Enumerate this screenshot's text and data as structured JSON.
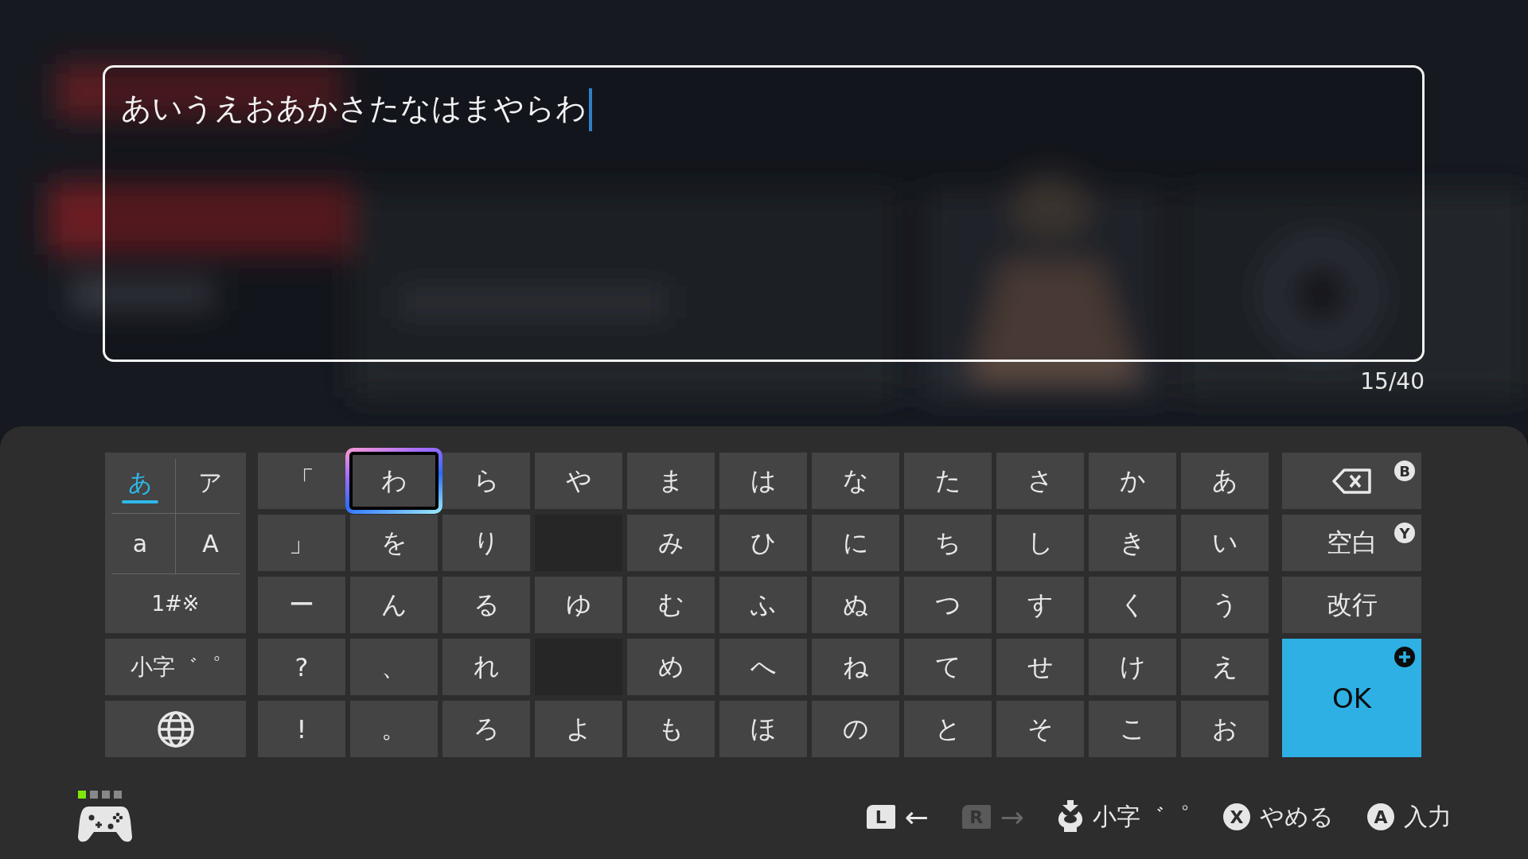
{
  "input": {
    "value": "あいうえおあかさたなはまやらわ",
    "counter": "15/40"
  },
  "modes": [
    {
      "label": "あ",
      "selected": true
    },
    {
      "label": "ア",
      "selected": false
    },
    {
      "label": "a",
      "selected": false
    },
    {
      "label": "A",
      "selected": false
    }
  ],
  "side_keys": [
    {
      "kind": "text",
      "label": "1#※"
    },
    {
      "kind": "text",
      "label": "小字゛゜"
    },
    {
      "kind": "globe"
    }
  ],
  "keys": [
    [
      {
        "kind": "char",
        "label": "「",
        "selected": false
      },
      {
        "kind": "char",
        "label": "わ",
        "selected": true
      },
      {
        "kind": "char",
        "label": "ら",
        "selected": false
      },
      {
        "kind": "char",
        "label": "や",
        "selected": false
      },
      {
        "kind": "char",
        "label": "ま",
        "selected": false
      },
      {
        "kind": "char",
        "label": "は",
        "selected": false
      },
      {
        "kind": "char",
        "label": "な",
        "selected": false
      },
      {
        "kind": "char",
        "label": "た",
        "selected": false
      },
      {
        "kind": "char",
        "label": "さ",
        "selected": false
      },
      {
        "kind": "char",
        "label": "か",
        "selected": false
      },
      {
        "kind": "char",
        "label": "あ",
        "selected": false
      }
    ],
    [
      {
        "kind": "char",
        "label": "」",
        "selected": false
      },
      {
        "kind": "char",
        "label": "を",
        "selected": false
      },
      {
        "kind": "char",
        "label": "り",
        "selected": false
      },
      {
        "kind": "blank",
        "selected": false
      },
      {
        "kind": "char",
        "label": "み",
        "selected": false
      },
      {
        "kind": "char",
        "label": "ひ",
        "selected": false
      },
      {
        "kind": "char",
        "label": "に",
        "selected": false
      },
      {
        "kind": "char",
        "label": "ち",
        "selected": false
      },
      {
        "kind": "char",
        "label": "し",
        "selected": false
      },
      {
        "kind": "char",
        "label": "き",
        "selected": false
      },
      {
        "kind": "char",
        "label": "い",
        "selected": false
      }
    ],
    [
      {
        "kind": "char",
        "label": "ー",
        "selected": false
      },
      {
        "kind": "char",
        "label": "ん",
        "selected": false
      },
      {
        "kind": "char",
        "label": "る",
        "selected": false
      },
      {
        "kind": "char",
        "label": "ゆ",
        "selected": false
      },
      {
        "kind": "char",
        "label": "む",
        "selected": false
      },
      {
        "kind": "char",
        "label": "ふ",
        "selected": false
      },
      {
        "kind": "char",
        "label": "ぬ",
        "selected": false
      },
      {
        "kind": "char",
        "label": "つ",
        "selected": false
      },
      {
        "kind": "char",
        "label": "す",
        "selected": false
      },
      {
        "kind": "char",
        "label": "く",
        "selected": false
      },
      {
        "kind": "char",
        "label": "う",
        "selected": false
      }
    ],
    [
      {
        "kind": "char",
        "label": "?",
        "selected": false
      },
      {
        "kind": "char",
        "label": "、",
        "selected": false
      },
      {
        "kind": "char",
        "label": "れ",
        "selected": false
      },
      {
        "kind": "blank",
        "selected": false
      },
      {
        "kind": "char",
        "label": "め",
        "selected": false
      },
      {
        "kind": "char",
        "label": "へ",
        "selected": false
      },
      {
        "kind": "char",
        "label": "ね",
        "selected": false
      },
      {
        "kind": "char",
        "label": "て",
        "selected": false
      },
      {
        "kind": "char",
        "label": "せ",
        "selected": false
      },
      {
        "kind": "char",
        "label": "け",
        "selected": false
      },
      {
        "kind": "char",
        "label": "え",
        "selected": false
      }
    ],
    [
      {
        "kind": "char",
        "label": "!",
        "selected": false
      },
      {
        "kind": "char",
        "label": "。",
        "selected": false
      },
      {
        "kind": "char",
        "label": "ろ",
        "selected": false
      },
      {
        "kind": "char",
        "label": "よ",
        "selected": false
      },
      {
        "kind": "char",
        "label": "も",
        "selected": false
      },
      {
        "kind": "char",
        "label": "ほ",
        "selected": false
      },
      {
        "kind": "char",
        "label": "の",
        "selected": false
      },
      {
        "kind": "char",
        "label": "と",
        "selected": false
      },
      {
        "kind": "char",
        "label": "そ",
        "selected": false
      },
      {
        "kind": "char",
        "label": "こ",
        "selected": false
      },
      {
        "kind": "char",
        "label": "お",
        "selected": false
      }
    ]
  ],
  "actions": [
    {
      "kind": "backspace",
      "badge": "B"
    },
    {
      "kind": "text",
      "label": "空白",
      "badge": "Y"
    },
    {
      "kind": "text",
      "label": "改行"
    },
    {
      "kind": "ok",
      "label": "OK"
    }
  ],
  "player": [
    {
      "on": true
    },
    {
      "on": false
    },
    {
      "on": false
    },
    {
      "on": false
    }
  ],
  "hints": [
    {
      "kind": "shoulder",
      "button": "L",
      "label": "←",
      "disabled": false
    },
    {
      "kind": "shoulder",
      "button": "R",
      "label": "→",
      "disabled": true
    },
    {
      "kind": "stick",
      "label": "小字゛゜",
      "disabled": false
    },
    {
      "kind": "face",
      "button": "X",
      "label": "やめる",
      "disabled": false
    },
    {
      "kind": "face",
      "button": "A",
      "label": "入力",
      "disabled": false
    }
  ]
}
